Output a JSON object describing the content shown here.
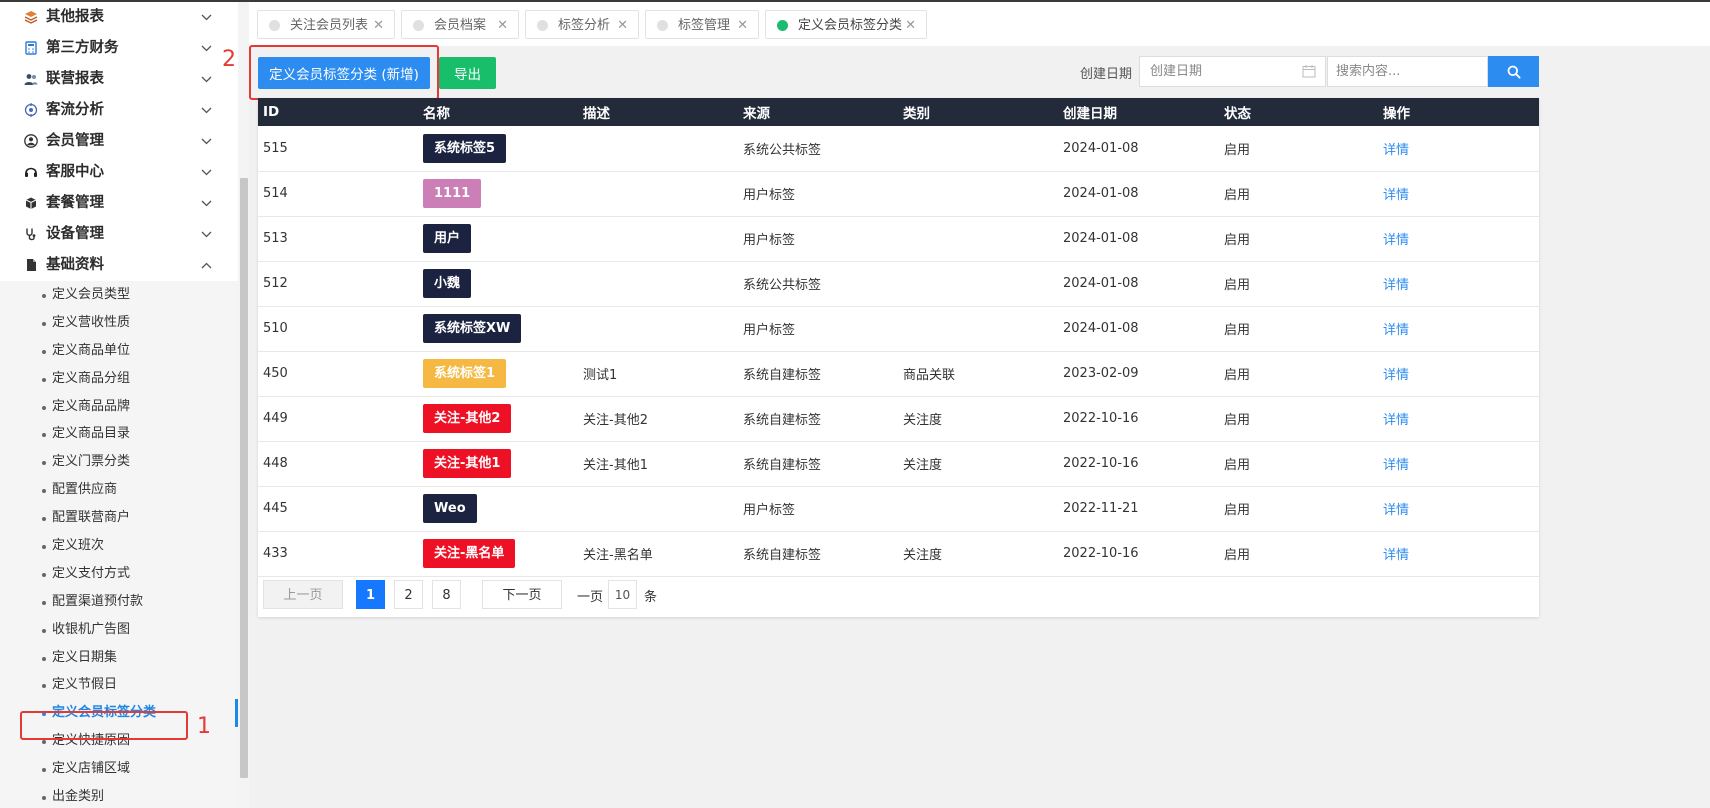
{
  "sidebar": {
    "menus": [
      {
        "label": "其他报表",
        "icon": "layers-icon",
        "expanded": false
      },
      {
        "label": "第三方财务",
        "icon": "calculator-icon",
        "expanded": false
      },
      {
        "label": "联营报表",
        "icon": "users-icon",
        "expanded": false
      },
      {
        "label": "客流分析",
        "icon": "target-icon",
        "expanded": false
      },
      {
        "label": "会员管理",
        "icon": "user-circle-icon",
        "expanded": false
      },
      {
        "label": "客服中心",
        "icon": "headset-icon",
        "expanded": false
      },
      {
        "label": "套餐管理",
        "icon": "package-icon",
        "expanded": false
      },
      {
        "label": "设备管理",
        "icon": "stethoscope-icon",
        "expanded": false
      },
      {
        "label": "基础资料",
        "icon": "document-icon",
        "expanded": true
      }
    ],
    "submenu": [
      "定义会员类型",
      "定义营收性质",
      "定义商品单位",
      "定义商品分组",
      "定义商品品牌",
      "定义商品目录",
      "定义门票分类",
      "配置供应商",
      "配置联营商户",
      "定义班次",
      "定义支付方式",
      "配置渠道预付款",
      "收银机广告图",
      "定义日期集",
      "定义节假日",
      "定义会员标签分类",
      "定义快捷原因",
      "定义店铺区域",
      "出金类别"
    ],
    "active_submenu": "定义会员标签分类"
  },
  "annotations": {
    "mark1": "1",
    "mark2": "2"
  },
  "tabs": [
    {
      "label": "关注会员列表",
      "active": false
    },
    {
      "label": "会员档案",
      "active": false
    },
    {
      "label": "标签分析",
      "active": false
    },
    {
      "label": "标签管理",
      "active": false
    },
    {
      "label": "定义会员标签分类",
      "active": true
    }
  ],
  "toolbar": {
    "add_label": "定义会员标签分类 (新增)",
    "export_label": "导出",
    "date_label": "创建日期",
    "date_placeholder": "创建日期",
    "search_placeholder": "搜索内容..."
  },
  "table": {
    "columns": [
      "ID",
      "名称",
      "描述",
      "来源",
      "类别",
      "创建日期",
      "状态",
      "操作"
    ],
    "rows": [
      {
        "id": "515",
        "name": "系统标签5",
        "color": "#1c2340",
        "desc": "",
        "source": "系统公共标签",
        "category": "",
        "date": "2024-01-08",
        "status": "启用",
        "action": "详情"
      },
      {
        "id": "514",
        "name": "1111",
        "color": "#cc7fb7",
        "desc": "",
        "source": "用户标签",
        "category": "",
        "date": "2024-01-08",
        "status": "启用",
        "action": "详情"
      },
      {
        "id": "513",
        "name": "用户",
        "color": "#1c2340",
        "desc": "",
        "source": "用户标签",
        "category": "",
        "date": "2024-01-08",
        "status": "启用",
        "action": "详情"
      },
      {
        "id": "512",
        "name": "小魏",
        "color": "#1c2340",
        "desc": "",
        "source": "系统公共标签",
        "category": "",
        "date": "2024-01-08",
        "status": "启用",
        "action": "详情"
      },
      {
        "id": "510",
        "name": "系统标签XW",
        "color": "#1c2340",
        "desc": "",
        "source": "用户标签",
        "category": "",
        "date": "2024-01-08",
        "status": "启用",
        "action": "详情"
      },
      {
        "id": "450",
        "name": "系统标签1",
        "color": "#f5b943",
        "desc": "测试1",
        "source": "系统自建标签",
        "category": "商品关联",
        "date": "2023-02-09",
        "status": "启用",
        "action": "详情"
      },
      {
        "id": "449",
        "name": "关注-其他2",
        "color": "#ee1126",
        "desc": "关注-其他2",
        "source": "系统自建标签",
        "category": "关注度",
        "date": "2022-10-16",
        "status": "启用",
        "action": "详情"
      },
      {
        "id": "448",
        "name": "关注-其他1",
        "color": "#ee1126",
        "desc": "关注-其他1",
        "source": "系统自建标签",
        "category": "关注度",
        "date": "2022-10-16",
        "status": "启用",
        "action": "详情"
      },
      {
        "id": "445",
        "name": "Weo",
        "color": "#1c2340",
        "desc": "",
        "source": "用户标签",
        "category": "",
        "date": "2022-11-21",
        "status": "启用",
        "action": "详情"
      },
      {
        "id": "433",
        "name": "关注-黑名单",
        "color": "#ee1126",
        "desc": "关注-黑名单",
        "source": "系统自建标签",
        "category": "关注度",
        "date": "2022-10-16",
        "status": "启用",
        "action": "详情"
      }
    ]
  },
  "pagination": {
    "prev_label": "上一页",
    "next_label": "下一页",
    "pages": [
      "1",
      "2",
      "8"
    ],
    "current": "1",
    "per_page_prefix": "一页",
    "per_page_value": "10",
    "per_page_suffix": "条"
  }
}
